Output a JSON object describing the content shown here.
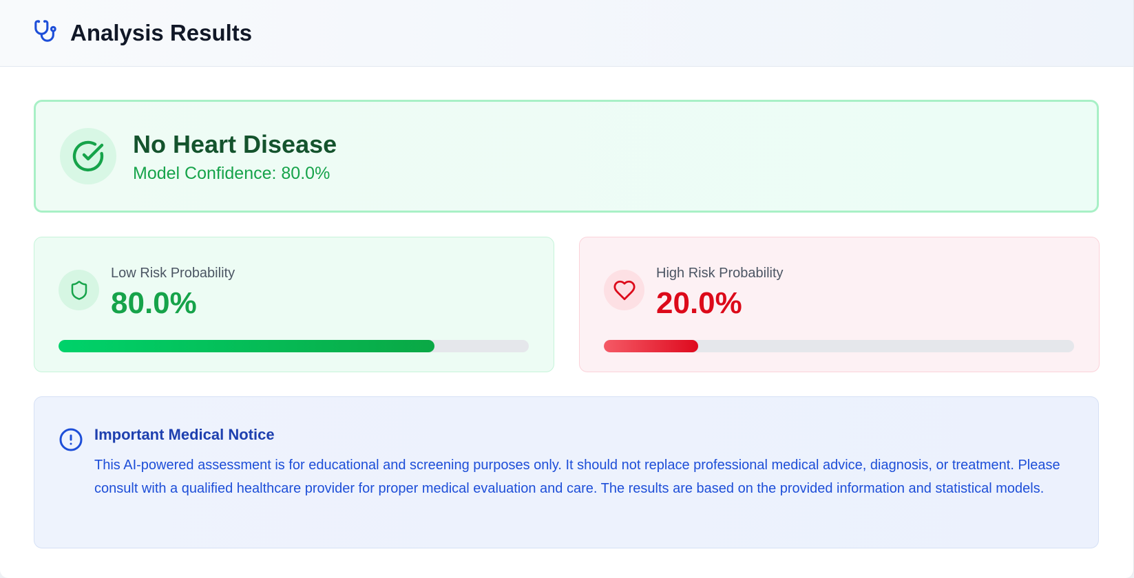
{
  "header": {
    "title": "Analysis Results",
    "icon": "stethoscope-icon"
  },
  "result": {
    "title": "No Heart Disease",
    "confidence_text": "Model Confidence: 80.0%",
    "icon": "check-circle-icon",
    "color": "#16a34a"
  },
  "low_risk": {
    "label": "Low Risk Probability",
    "value_text": "80.0%",
    "value": 80.0,
    "icon": "shield-icon",
    "color": "#16a34a"
  },
  "high_risk": {
    "label": "High Risk Probability",
    "value_text": "20.0%",
    "value": 20.0,
    "icon": "heart-icon",
    "color": "#dc0a1a"
  },
  "notice": {
    "title": "Important Medical Notice",
    "icon": "alert-circle-icon",
    "text": "This AI-powered assessment is for educational and screening purposes only. It should not replace professional medical advice, diagnosis, or treatment. Please consult with a qualified healthcare provider for proper medical evaluation and care. The results are based on the provided information and statistical models."
  }
}
